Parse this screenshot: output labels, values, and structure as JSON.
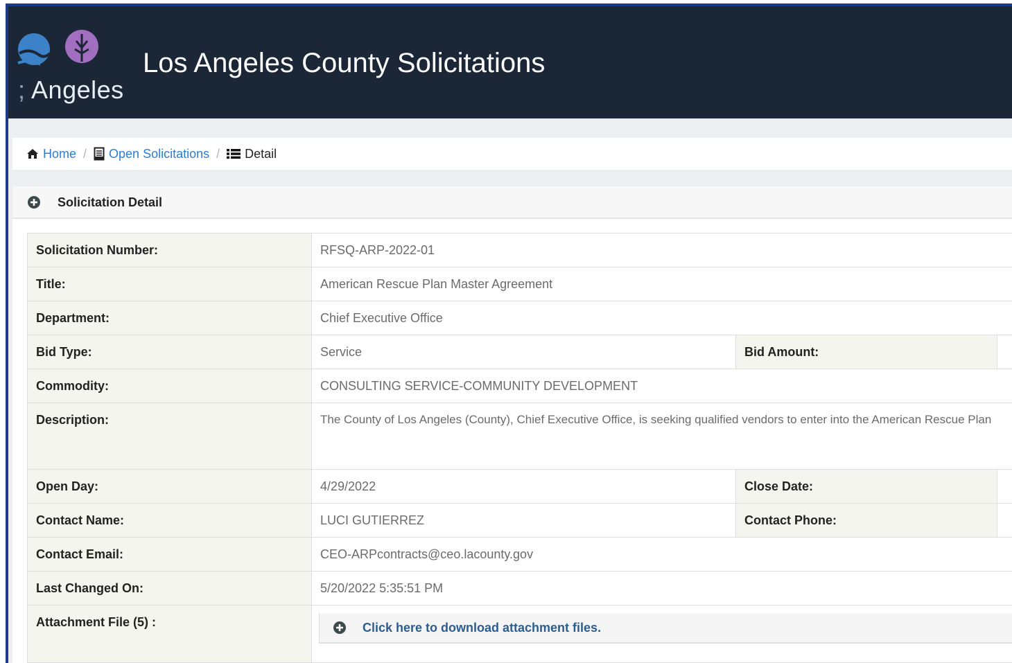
{
  "header": {
    "logo_text": "Angeles",
    "title": "Los Angeles County Solicitations"
  },
  "breadcrumb": {
    "home": "Home",
    "open_solicitations": "Open Solicitations",
    "current": "Detail"
  },
  "panel": {
    "title": "Solicitation Detail"
  },
  "details": {
    "solicitation_number": {
      "label": "Solicitation Number:",
      "value": "RFSQ-ARP-2022-01"
    },
    "title": {
      "label": "Title:",
      "value": "American Rescue Plan Master Agreement"
    },
    "department": {
      "label": "Department:",
      "value": "Chief Executive Office"
    },
    "bid_type": {
      "label": "Bid Type:",
      "value": "Service"
    },
    "bid_amount": {
      "label": "Bid Amount:"
    },
    "commodity": {
      "label": "Commodity:",
      "value": "CONSULTING SERVICE-COMMUNITY DEVELOPMENT"
    },
    "description": {
      "label": "Description:",
      "value": "The County of Los Angeles (County), Chief Executive Office, is seeking qualified vendors to enter into the American Rescue Plan"
    },
    "open_day": {
      "label": "Open Day:",
      "value": "4/29/2022"
    },
    "close_date": {
      "label": "Close Date:"
    },
    "contact_name": {
      "label": "Contact Name:",
      "value": "LUCI GUTIERREZ"
    },
    "contact_phone": {
      "label": "Contact Phone:"
    },
    "contact_email": {
      "label": "Contact Email:",
      "value": "CEO-ARPcontracts@ceo.lacounty.gov"
    },
    "last_changed": {
      "label": "Last Changed On:",
      "value": "5/20/2022 5:35:51 PM"
    },
    "attachment": {
      "label": "Attachment File (5) :",
      "link": "Click here to download attachment files."
    }
  },
  "colors": {
    "header_bg": "#1b2636",
    "link": "#2b7ed2",
    "label_bg": "#f5f5ef",
    "frame_border": "#1a3a8a"
  },
  "icons": [
    "home-icon",
    "document-icon",
    "list-icon",
    "plus-circle-icon",
    "logo-sun-icon",
    "logo-palm-icon"
  ]
}
